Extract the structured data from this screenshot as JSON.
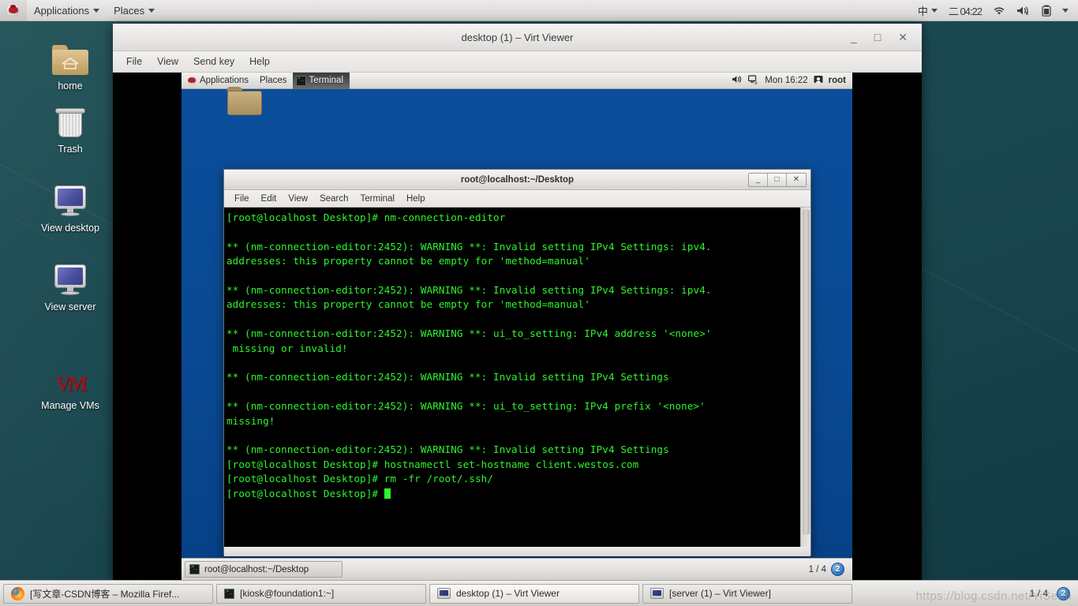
{
  "host_panel": {
    "logo": "redhat-logo-icon",
    "applications_label": "Applications",
    "places_label": "Places",
    "input_method": "中",
    "clock": "二 04:22",
    "icons": [
      "wifi-icon",
      "volume-muted-icon",
      "battery-icon",
      "system-menu-caret-icon"
    ]
  },
  "desktop_icons": [
    {
      "label": "home",
      "icon": "home-folder-icon"
    },
    {
      "label": "Trash",
      "icon": "trash-icon"
    },
    {
      "label": "View desktop",
      "icon": "monitor-icon"
    },
    {
      "label": "View server",
      "icon": "monitor-icon"
    },
    {
      "label": "Manage VMs",
      "icon": "virt-manager-icon"
    }
  ],
  "virt_viewer": {
    "title": "desktop (1) – Virt Viewer",
    "window_buttons": {
      "minimize": "_",
      "maximize": "□",
      "close": "✕"
    },
    "menu": [
      "File",
      "View",
      "Send key",
      "Help"
    ]
  },
  "guest": {
    "panel": {
      "applications_label": "Applications",
      "places_label": "Places",
      "window_button": "Terminal",
      "clock": "Mon 16:22",
      "user": "root",
      "icons": [
        "volume-icon",
        "network-disconnected-icon",
        "user-icon"
      ]
    },
    "terminal": {
      "title": "root@localhost:~/Desktop",
      "menu": [
        "File",
        "Edit",
        "View",
        "Search",
        "Terminal",
        "Help"
      ],
      "window_buttons": {
        "minimize": "_",
        "maximize": "□",
        "close": "✕"
      },
      "lines": [
        "[root@localhost Desktop]# nm-connection-editor",
        "",
        "** (nm-connection-editor:2452): WARNING **: Invalid setting IPv4 Settings: ipv4.",
        "addresses: this property cannot be empty for 'method=manual'",
        "",
        "** (nm-connection-editor:2452): WARNING **: Invalid setting IPv4 Settings: ipv4.",
        "addresses: this property cannot be empty for 'method=manual'",
        "",
        "** (nm-connection-editor:2452): WARNING **: ui_to_setting: IPv4 address '<none>'",
        " missing or invalid!",
        "",
        "** (nm-connection-editor:2452): WARNING **: Invalid setting IPv4 Settings",
        "",
        "** (nm-connection-editor:2452): WARNING **: ui_to_setting: IPv4 prefix '<none>'",
        "missing!",
        "",
        "** (nm-connection-editor:2452): WARNING **: Invalid setting IPv4 Settings",
        "[root@localhost Desktop]# hostnamectl set-hostname client.westos.com",
        "[root@localhost Desktop]# rm -fr /root/.ssh/",
        "[root@localhost Desktop]# "
      ],
      "text_color": "#2ef52e",
      "background_color": "#000000"
    },
    "taskbar": {
      "window_button": "root@localhost:~/Desktop",
      "workspace": "1 / 4",
      "workspace_badge": "2"
    }
  },
  "host_taskbar": {
    "items": [
      {
        "label": "[写文章-CSDN博客 – Mozilla Firef...",
        "icon": "firefox-icon"
      },
      {
        "label": "[kiosk@foundation1:~]",
        "icon": "terminal-icon"
      },
      {
        "label": "desktop (1) – Virt Viewer",
        "icon": "monitor-icon",
        "active": true
      },
      {
        "label": "[server (1) – Virt Viewer]",
        "icon": "monitor-icon"
      }
    ],
    "workspace": "1 / 4",
    "workspace_badge": "2",
    "watermark": "https://blog.csdn.net/YiSean"
  }
}
